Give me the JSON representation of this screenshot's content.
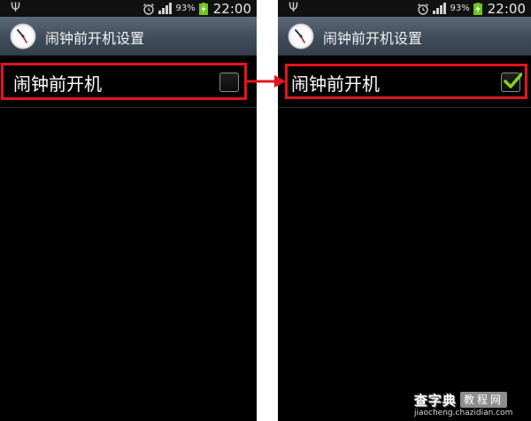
{
  "screens": [
    {
      "status": {
        "battery_percent": "93%",
        "time": "22:00"
      },
      "title": "闹钟前开机设置",
      "setting": {
        "label": "闹钟前开机",
        "checked": false
      }
    },
    {
      "status": {
        "battery_percent": "93%",
        "time": "22:00"
      },
      "title": "闹钟前开机设置",
      "setting": {
        "label": "闹钟前开机",
        "checked": true
      }
    }
  ],
  "colors": {
    "highlight": "#e3151c",
    "arrow": "#e3151c",
    "check": "#7fd321",
    "titlebar": "#465462"
  },
  "icons": [
    "usb-icon",
    "alarm-icon",
    "signal-icon",
    "battery-charging-icon",
    "clock-app-icon",
    "checkmark-icon",
    "arrow-right-icon"
  ],
  "watermark": {
    "brand": "查字典",
    "tag": "教程网",
    "url": "jiaocheng.chazidian.com"
  }
}
